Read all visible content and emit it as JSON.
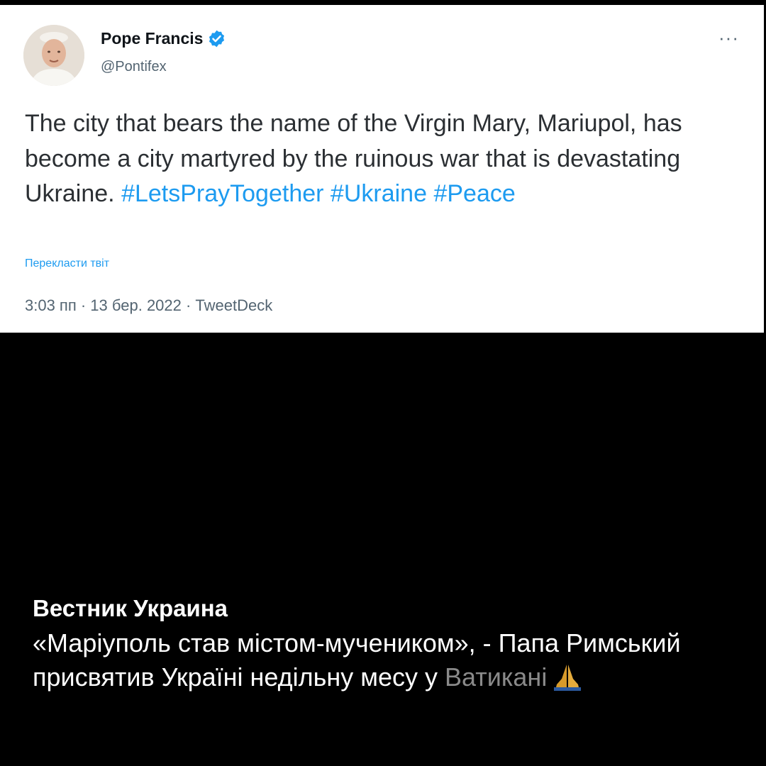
{
  "tweet": {
    "author_name": "Pope Francis",
    "author_handle": "@Pontifex",
    "text_parts": {
      "line1": "The city that bears the name of the Virgin Mary, Mariupol, has become a city martyred by the ruinous war that is devastating Ukraine. ",
      "hashtag1": "#LetsPrayTogether",
      "space1": " ",
      "hashtag2": "#Ukraine",
      "space2": " ",
      "hashtag3": "#Peace"
    },
    "translate_label": "Перекласти твіт",
    "meta": "3:03 пп · 13 бер. 2022 · TweetDeck",
    "more_icon": "···",
    "colors": {
      "link": "#1d9bf0",
      "verified": "#1d9bf0"
    }
  },
  "caption": {
    "source": "Вестник Украина",
    "text_main": "«Маріуполь став містом-мучеником», - Папа Римський присвятив Україні недільну месу у ",
    "text_faded": "Ватикані",
    "icon": "praying-hands-icon"
  }
}
